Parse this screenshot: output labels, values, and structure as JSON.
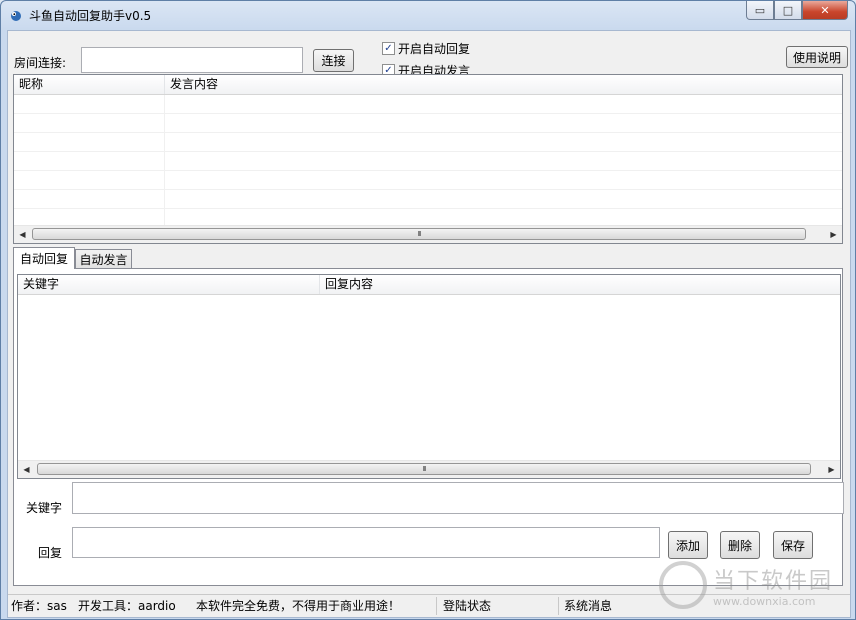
{
  "window": {
    "title": "斗鱼自动回复助手v0.5",
    "controls": {
      "minimize": "▭",
      "maximize": "□",
      "close": "✕"
    }
  },
  "toolbar": {
    "room_label": "房间连接:",
    "room_value": "",
    "connect_label": "连接",
    "auto_reply_label": "开启自动回复",
    "auto_reply_checked": true,
    "auto_speak_label": "开启自动发言",
    "auto_speak_checked": true,
    "help_label": "使用说明"
  },
  "chat_list": {
    "columns": [
      "昵称",
      "发言内容"
    ],
    "rows": []
  },
  "tabs": [
    {
      "label": "自动回复",
      "active": true
    },
    {
      "label": "自动发言",
      "active": false
    }
  ],
  "reply_list": {
    "columns": [
      "关键字",
      "回复内容"
    ],
    "rows": []
  },
  "form": {
    "keyword_label": "关键字",
    "keyword_value": "",
    "reply_label": "回复",
    "reply_value": "",
    "add_label": "添加",
    "delete_label": "删除",
    "save_label": "保存"
  },
  "scrollbar": {
    "thumb_grip": "III",
    "left_arrow": "◀",
    "right_arrow": "▶"
  },
  "statusbar": {
    "author": "作者：sas",
    "tool": "开发工具：aardio",
    "notice": "本软件完全免费，不得用于商业用途！",
    "login_status": "登陆状态",
    "system_message": "系统消息"
  },
  "watermark": {
    "name": "当下软件园",
    "url": "www.downxia.com"
  },
  "colors": {
    "accent": "#1f3f8f",
    "close_button": "#c9452c",
    "titlebar": "#c9d9ee"
  }
}
